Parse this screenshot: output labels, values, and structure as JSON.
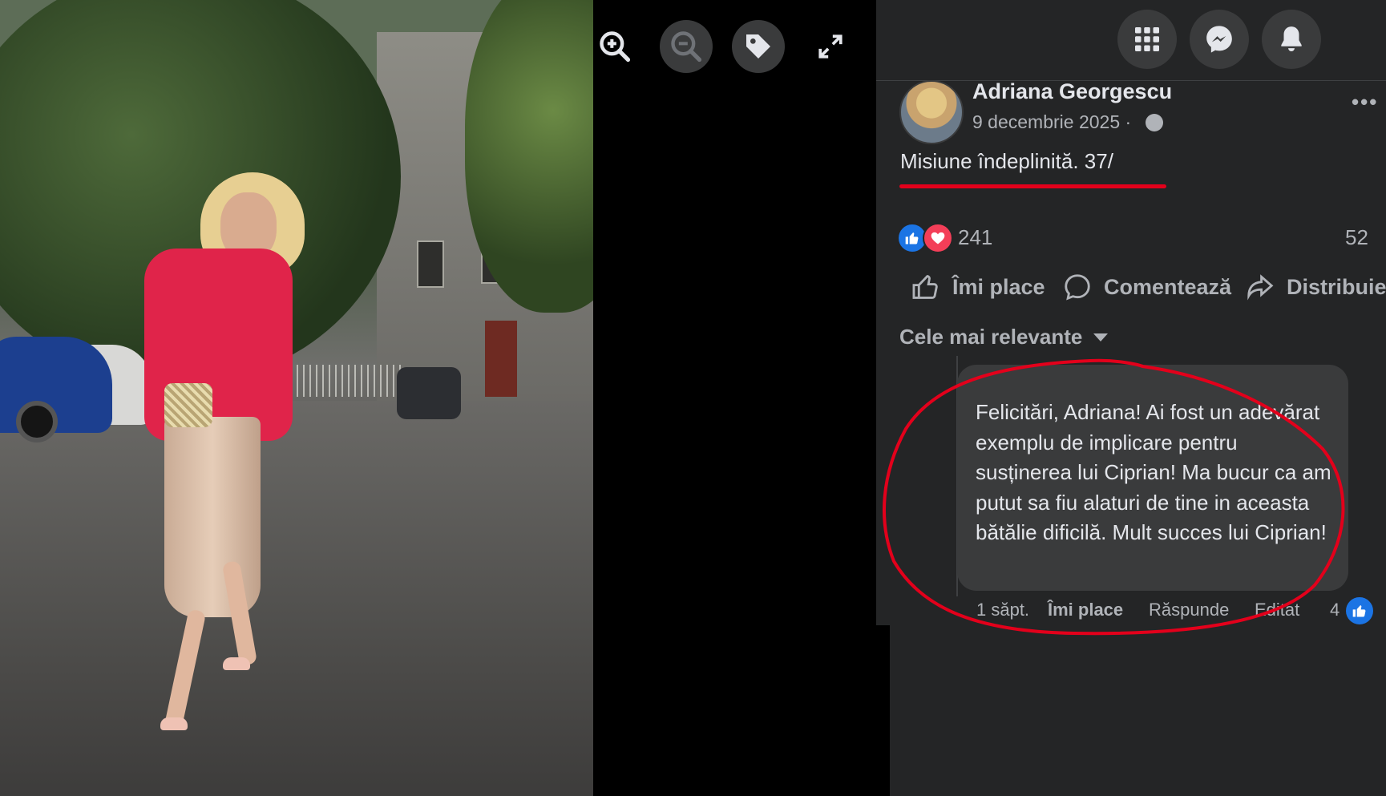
{
  "post": {
    "author": "Adriana Georgescu",
    "date": "9 decembrie 2025 ·",
    "text": "Misiune îndeplinită. 37/",
    "reactions_count": "241",
    "comments_count": "52"
  },
  "actions": {
    "like": "Îmi place",
    "comment": "Comentează",
    "share": "Distribuie"
  },
  "comments_sort": "Cele mai relevante",
  "comment": {
    "text": "Felicitări, Adriana! Ai fost un adevărat exemplu de implicare pentru susținerea lui Ciprian! Ma bucur ca am putut sa fiu alaturi de tine in aceasta bătălie dificilă. Mult succes lui Ciprian!",
    "time": "1 săpt.",
    "like": "Îmi place",
    "reply": "Răspunde",
    "edited": "Editat",
    "like_count": "4"
  },
  "icons": {
    "viewer": [
      "zoom-in-icon",
      "zoom-out-icon",
      "tag-icon",
      "fullscreen-icon"
    ],
    "top": [
      "menu-grid-icon",
      "messenger-icon",
      "bell-icon"
    ]
  },
  "colors": {
    "panel": "#242526",
    "button": "#3a3b3c",
    "text": "#e4e6eb",
    "secondary": "#b0b3b8",
    "like_blue": "#1b74e4",
    "love_red": "#f33e58",
    "annotation_red": "#e3001b"
  }
}
